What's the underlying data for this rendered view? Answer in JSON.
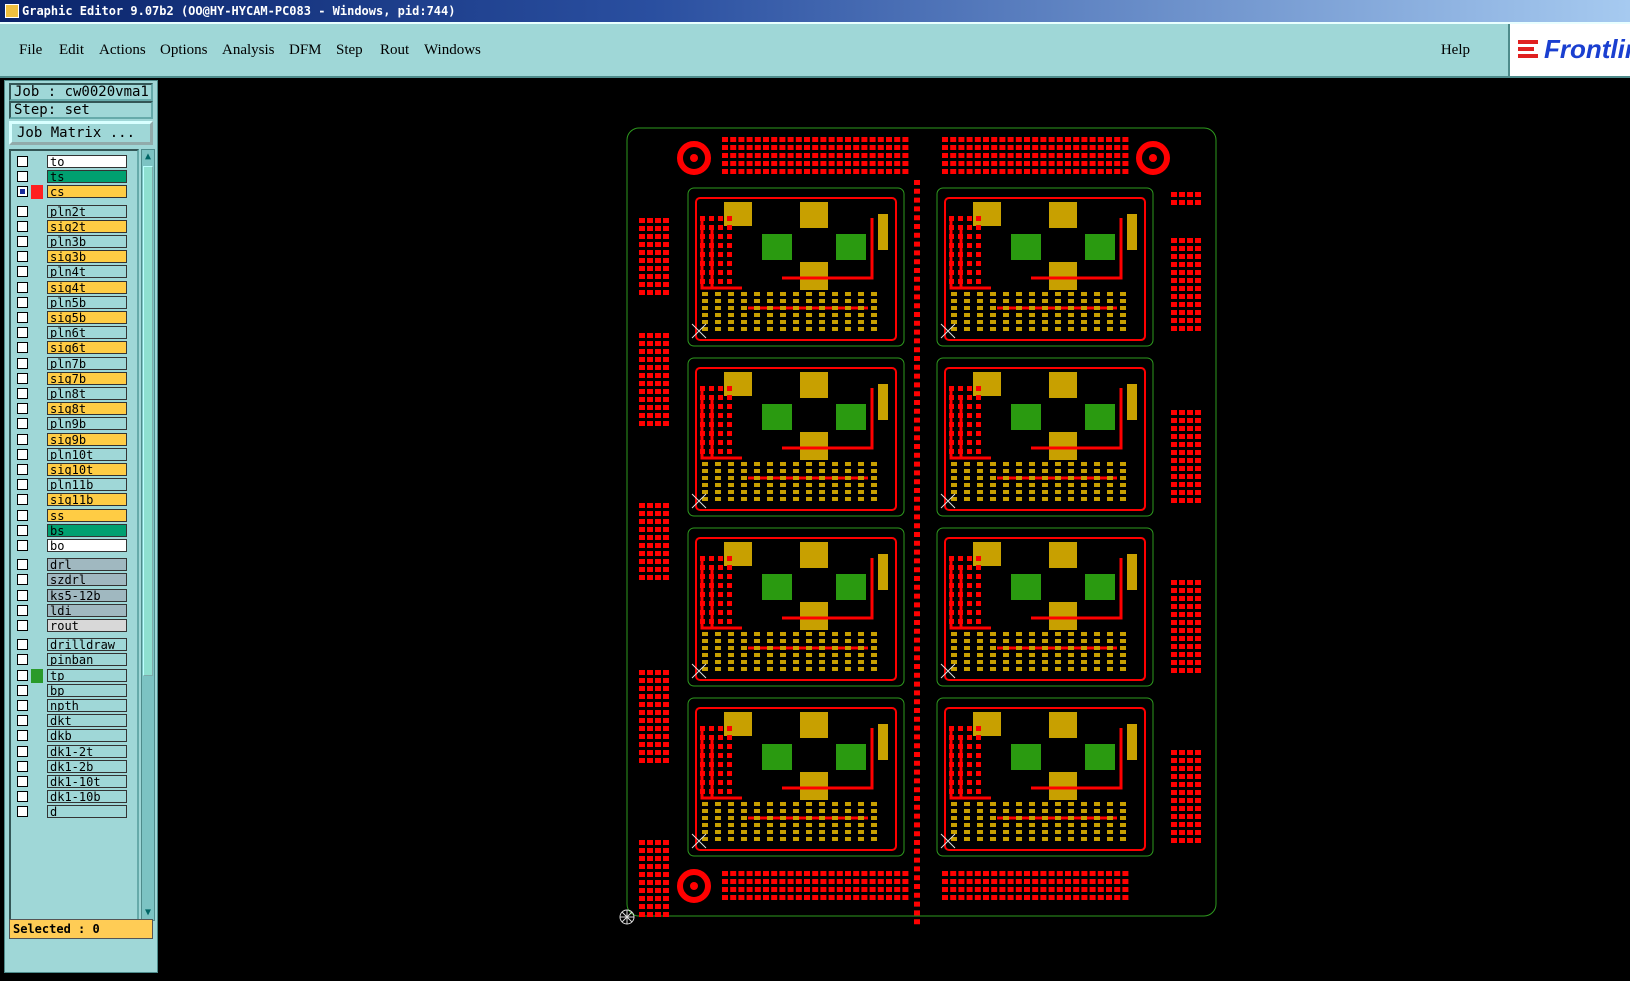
{
  "window": {
    "title": "Graphic Editor 9.07b2 (OO@HY-HYCAM-PC083 - Windows, pid:744)"
  },
  "menubar": {
    "items": [
      "File",
      "Edit",
      "Actions",
      "Options",
      "Analysis",
      "DFM",
      "Step",
      "Rout",
      "Windows"
    ],
    "help": "Help",
    "logo": "Frontline"
  },
  "panel": {
    "job": "Job : cw0020vma1",
    "step": "Step: set",
    "job_matrix": "Job Matrix ...",
    "selected": "Selected : 0"
  },
  "layers": [
    {
      "name": "to",
      "bg": "#ffffff",
      "color": ""
    },
    {
      "name": "ts",
      "bg": "#00a070",
      "color": ""
    },
    {
      "name": "cs",
      "bg": "#ffcc44",
      "color": "#ff2020",
      "work": true
    },
    {
      "name": "pln2t",
      "bg": "#9fd7d7",
      "color": ""
    },
    {
      "name": "sig2t",
      "bg": "#ffcc44",
      "color": ""
    },
    {
      "name": "pln3b",
      "bg": "#9fd7d7",
      "color": ""
    },
    {
      "name": "sig3b",
      "bg": "#ffcc44",
      "color": ""
    },
    {
      "name": "pln4t",
      "bg": "#9fd7d7",
      "color": ""
    },
    {
      "name": "sig4t",
      "bg": "#ffcc44",
      "color": ""
    },
    {
      "name": "pln5b",
      "bg": "#9fd7d7",
      "color": ""
    },
    {
      "name": "sig5b",
      "bg": "#ffcc44",
      "color": ""
    },
    {
      "name": "pln6t",
      "bg": "#9fd7d7",
      "color": ""
    },
    {
      "name": "sig6t",
      "bg": "#ffcc44",
      "color": ""
    },
    {
      "name": "pln7b",
      "bg": "#9fd7d7",
      "color": ""
    },
    {
      "name": "sig7b",
      "bg": "#ffcc44",
      "color": ""
    },
    {
      "name": "pln8t",
      "bg": "#9fd7d7",
      "color": ""
    },
    {
      "name": "sig8t",
      "bg": "#ffcc44",
      "color": ""
    },
    {
      "name": "pln9b",
      "bg": "#9fd7d7",
      "color": ""
    },
    {
      "name": "sig9b",
      "bg": "#ffcc44",
      "color": ""
    },
    {
      "name": "pln10t",
      "bg": "#9fd7d7",
      "color": ""
    },
    {
      "name": "sig10t",
      "bg": "#ffcc44",
      "color": ""
    },
    {
      "name": "pln11b",
      "bg": "#9fd7d7",
      "color": ""
    },
    {
      "name": "sig11b",
      "bg": "#ffcc44",
      "color": ""
    },
    {
      "name": "ss",
      "bg": "#ffcc44",
      "color": ""
    },
    {
      "name": "bs",
      "bg": "#00a070",
      "color": ""
    },
    {
      "name": "bo",
      "bg": "#ffffff",
      "color": ""
    },
    {
      "name": "drl",
      "bg": "#a0b8c0",
      "color": ""
    },
    {
      "name": "szdrl",
      "bg": "#a0b8c0",
      "color": ""
    },
    {
      "name": "ks5-12b",
      "bg": "#a0b8c0",
      "color": ""
    },
    {
      "name": "ldi",
      "bg": "#a0b8c0",
      "color": ""
    },
    {
      "name": "rout",
      "bg": "#d8d8d8",
      "color": ""
    },
    {
      "name": "drilldraw",
      "bg": "#9fd7d7",
      "color": ""
    },
    {
      "name": "pinban",
      "bg": "#9fd7d7",
      "color": ""
    },
    {
      "name": "tp",
      "bg": "#9fd7d7",
      "color": "#2a9a2a"
    },
    {
      "name": "bp",
      "bg": "#9fd7d7",
      "color": ""
    },
    {
      "name": "npth",
      "bg": "#9fd7d7",
      "color": ""
    },
    {
      "name": "dkt",
      "bg": "#9fd7d7",
      "color": ""
    },
    {
      "name": "dkb",
      "bg": "#9fd7d7",
      "color": ""
    },
    {
      "name": "dk1-2t",
      "bg": "#9fd7d7",
      "color": ""
    },
    {
      "name": "dk1-2b",
      "bg": "#9fd7d7",
      "color": ""
    },
    {
      "name": "dk1-10t",
      "bg": "#9fd7d7",
      "color": ""
    },
    {
      "name": "dk1-10b",
      "bg": "#9fd7d7",
      "color": ""
    },
    {
      "name": "d",
      "bg": "#9fd7d7",
      "color": ""
    }
  ],
  "colors": {
    "outline": "#2e9a1e",
    "copper": "#ff0000",
    "pad": "#c8a000",
    "green": "#2a9a10"
  }
}
